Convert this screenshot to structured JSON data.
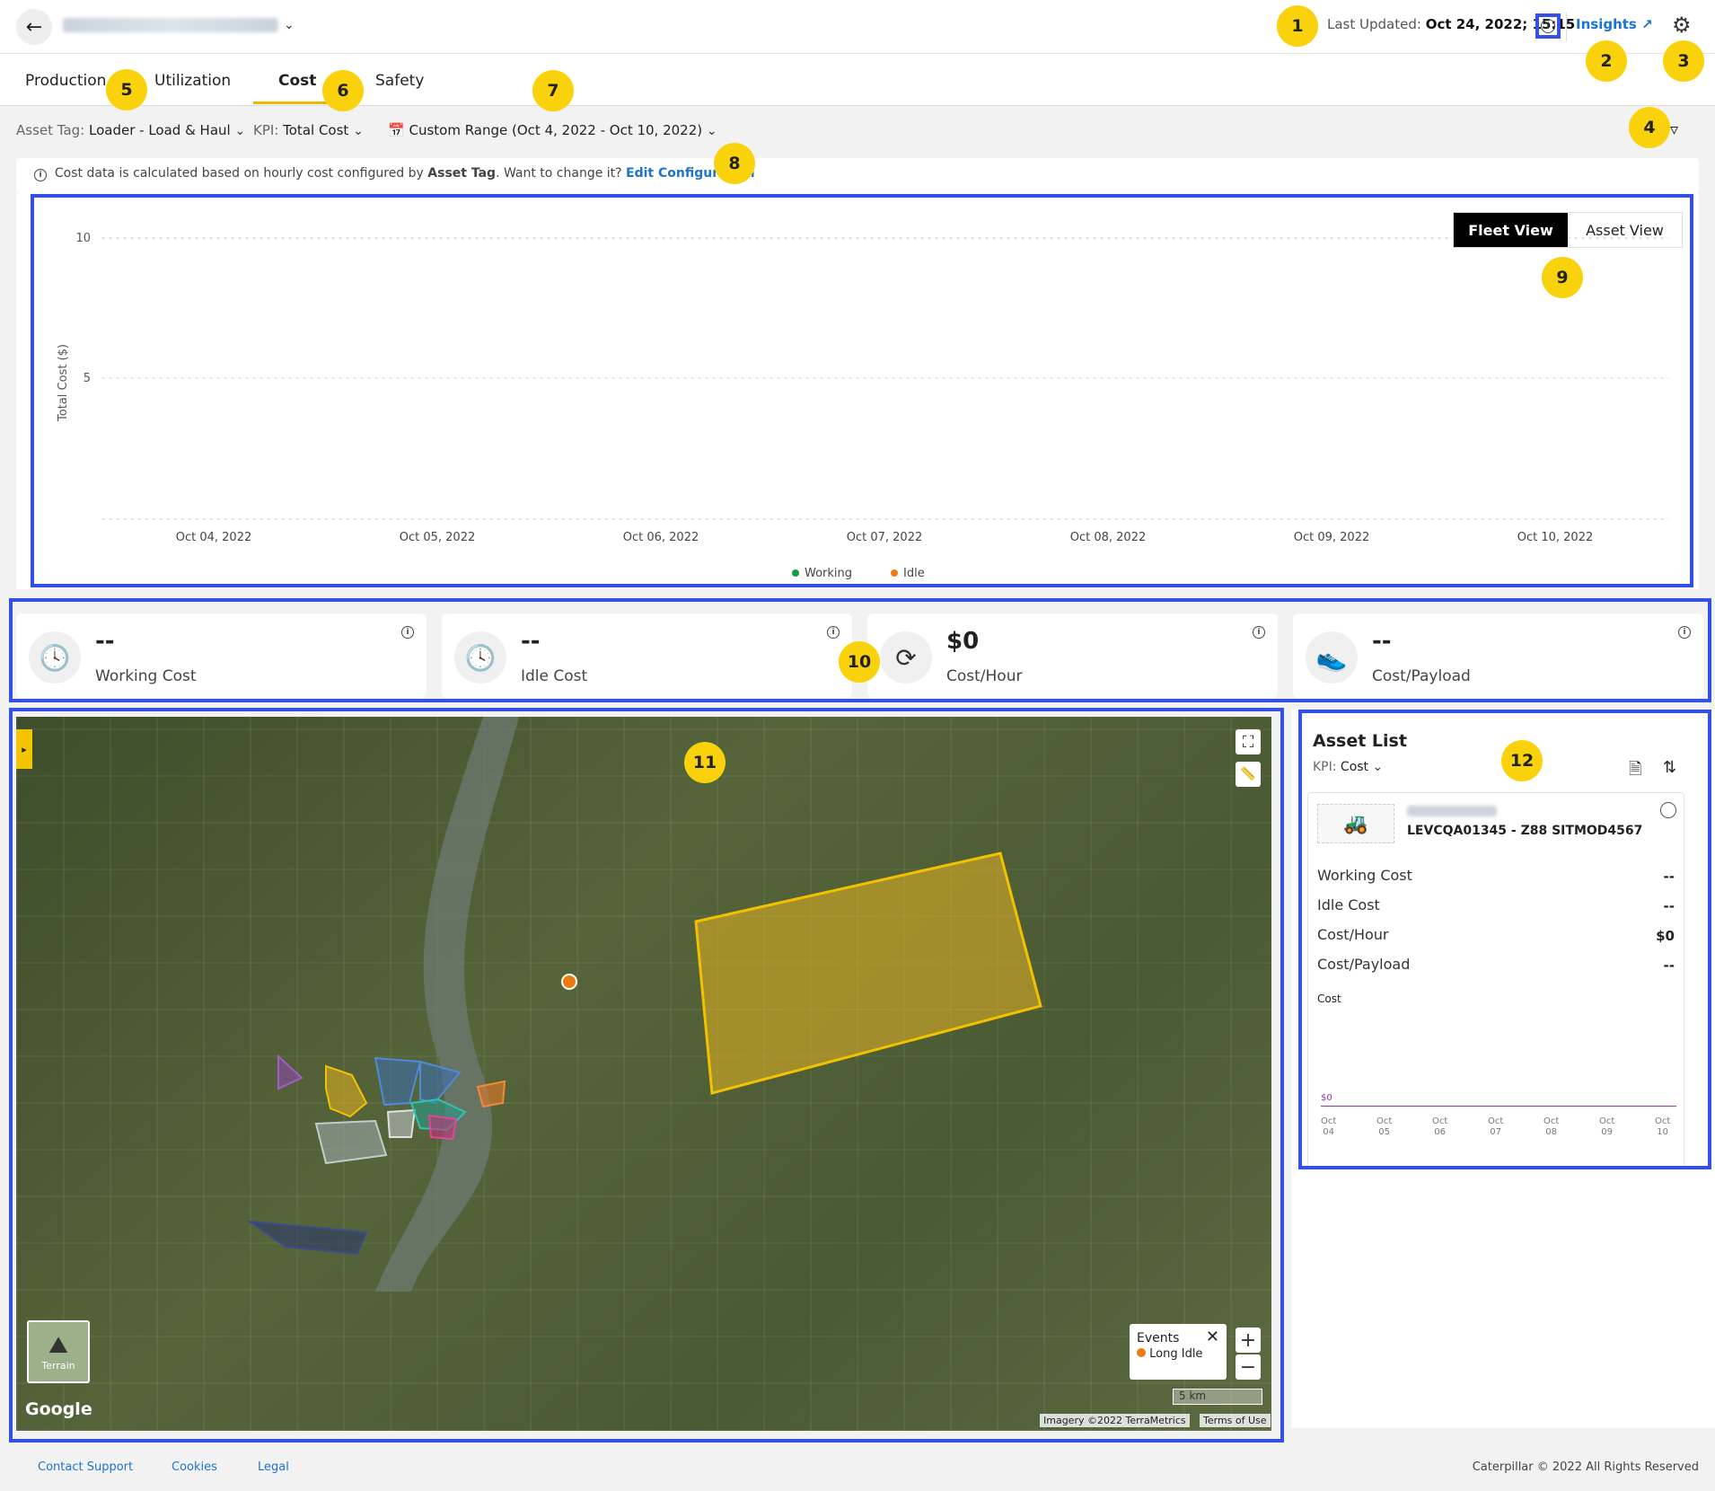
{
  "header": {
    "last_updated_label": "Last Updated:",
    "last_updated_value": "Oct 24, 2022; 15:15",
    "insights_label": "Insights"
  },
  "tabs": [
    {
      "label": "Production"
    },
    {
      "label": "Utilization"
    },
    {
      "label": "Cost"
    },
    {
      "label": "Safety"
    }
  ],
  "filters": {
    "asset_tag_label": "Asset Tag:",
    "asset_tag_value": "Loader - Load & Haul",
    "kpi_label": "KPI:",
    "kpi_value": "Total Cost",
    "date_range": "Custom Range (Oct 4, 2022 - Oct 10, 2022)"
  },
  "banner": {
    "text_a": "Cost data is calculated based on hourly cost configured by",
    "text_bold": "Asset Tag",
    "text_b": ". Want to change it?",
    "link": "Edit Configuration"
  },
  "view_toggle": {
    "fleet": "Fleet View",
    "asset": "Asset View"
  },
  "chart_data": {
    "type": "bar",
    "title": "",
    "xlabel": "",
    "ylabel": "Total Cost ($)",
    "categories": [
      "Oct 04, 2022",
      "Oct 05, 2022",
      "Oct 06, 2022",
      "Oct 07, 2022",
      "Oct 08, 2022",
      "Oct 09, 2022",
      "Oct 10, 2022"
    ],
    "ylim": [
      0,
      10
    ],
    "yticks": [
      "10",
      "5"
    ],
    "series": [
      {
        "name": "Working",
        "color": "#1a9b3c",
        "values": [
          0,
          0,
          0,
          0,
          0,
          0,
          0
        ]
      },
      {
        "name": "Idle",
        "color": "#f07a12",
        "values": [
          0,
          0,
          0,
          0,
          0,
          0,
          0
        ]
      }
    ],
    "grid": true,
    "legend": "bottom-center"
  },
  "kpis": [
    {
      "value": "--",
      "label": "Working Cost",
      "icon": "clock-icon"
    },
    {
      "value": "--",
      "label": "Idle Cost",
      "icon": "clock-icon"
    },
    {
      "value": "$0",
      "label": "Cost/Hour",
      "icon": "refresh-icon"
    },
    {
      "value": "--",
      "label": "Cost/Payload",
      "icon": "payload-icon"
    }
  ],
  "map": {
    "legend_title": "Events",
    "legend_item": "Long Idle",
    "legend_color": "#f07a12",
    "terrain_label": "Terrain",
    "scale": "5 km",
    "attribution": "Imagery ©2022 TerraMetrics",
    "terms": "Terms of Use",
    "google": "Google"
  },
  "asset_list": {
    "title": "Asset List",
    "kpi_label": "KPI:",
    "kpi_value": "Cost",
    "asset_name": "LEVCQA01345 - Z88 SITMOD4567",
    "rows": [
      {
        "label": "Working Cost",
        "value": "--"
      },
      {
        "label": "Idle Cost",
        "value": "--"
      },
      {
        "label": "Cost/Hour",
        "value": "$0"
      },
      {
        "label": "Cost/Payload",
        "value": "--"
      }
    ],
    "mini_chart_label": "Cost",
    "mini_y": "$0",
    "mini_dates": [
      [
        "Oct",
        "04"
      ],
      [
        "Oct",
        "05"
      ],
      [
        "Oct",
        "06"
      ],
      [
        "Oct",
        "07"
      ],
      [
        "Oct",
        "08"
      ],
      [
        "Oct",
        "09"
      ],
      [
        "Oct",
        "10"
      ]
    ]
  },
  "footer": {
    "contact": "Contact Support",
    "cookies": "Cookies",
    "legal": "Legal",
    "copyright": "Caterpillar © 2022 All Rights Reserved"
  },
  "callouts": [
    "1",
    "2",
    "3",
    "4",
    "5",
    "6",
    "7",
    "8",
    "9",
    "10",
    "11",
    "12"
  ]
}
